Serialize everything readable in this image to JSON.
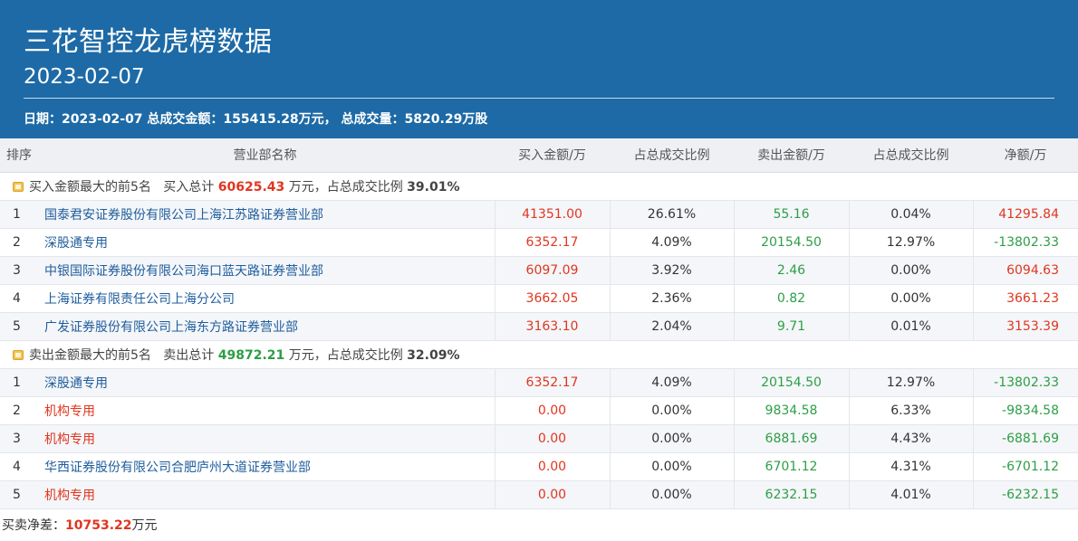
{
  "header": {
    "title": "三花智控龙虎榜数据",
    "date": "2023-02-07",
    "summary": "日期：2023-02-07 总成交金额：155415.28万元， 总成交量：5820.29万股"
  },
  "columns": [
    "排序",
    "营业部名称",
    "买入金额/万",
    "占总成交比例",
    "卖出金额/万",
    "占总成交比例",
    "净额/万"
  ],
  "buy_group": {
    "label": "买入金额最大的前5名",
    "total_label": "买入总计",
    "total_value": "60625.43",
    "unit_text": "万元，占总成交比例",
    "ratio": "39.01%",
    "rows": [
      {
        "rank": "1",
        "name": "国泰君安证券股份有限公司上海江苏路证券营业部",
        "buy": "41351.00",
        "buy_pct": "26.61%",
        "sell": "55.16",
        "sell_pct": "0.04%",
        "net": "41295.84"
      },
      {
        "rank": "2",
        "name": "深股通专用",
        "buy": "6352.17",
        "buy_pct": "4.09%",
        "sell": "20154.50",
        "sell_pct": "12.97%",
        "net": "-13802.33"
      },
      {
        "rank": "3",
        "name": "中银国际证券股份有限公司海口蓝天路证券营业部",
        "buy": "6097.09",
        "buy_pct": "3.92%",
        "sell": "2.46",
        "sell_pct": "0.00%",
        "net": "6094.63"
      },
      {
        "rank": "4",
        "name": "上海证券有限责任公司上海分公司",
        "buy": "3662.05",
        "buy_pct": "2.36%",
        "sell": "0.82",
        "sell_pct": "0.00%",
        "net": "3661.23"
      },
      {
        "rank": "5",
        "name": "广发证券股份有限公司上海东方路证券营业部",
        "buy": "3163.10",
        "buy_pct": "2.04%",
        "sell": "9.71",
        "sell_pct": "0.01%",
        "net": "3153.39"
      }
    ]
  },
  "sell_group": {
    "label": "卖出金额最大的前5名",
    "total_label": "卖出总计",
    "total_value": "49872.21",
    "unit_text": "万元，占总成交比例",
    "ratio": "32.09%",
    "rows": [
      {
        "rank": "1",
        "name": "深股通专用",
        "buy": "6352.17",
        "buy_pct": "4.09%",
        "sell": "20154.50",
        "sell_pct": "12.97%",
        "net": "-13802.33"
      },
      {
        "rank": "2",
        "name": "机构专用",
        "buy": "0.00",
        "buy_pct": "0.00%",
        "sell": "9834.58",
        "sell_pct": "6.33%",
        "net": "-9834.58"
      },
      {
        "rank": "3",
        "name": "机构专用",
        "buy": "0.00",
        "buy_pct": "0.00%",
        "sell": "6881.69",
        "sell_pct": "4.43%",
        "net": "-6881.69"
      },
      {
        "rank": "4",
        "name": "华西证券股份有限公司合肥庐州大道证券营业部",
        "buy": "0.00",
        "buy_pct": "0.00%",
        "sell": "6701.12",
        "sell_pct": "4.31%",
        "net": "-6701.12"
      },
      {
        "rank": "5",
        "name": "机构专用",
        "buy": "0.00",
        "buy_pct": "0.00%",
        "sell": "6232.15",
        "sell_pct": "4.01%",
        "net": "-6232.15"
      }
    ]
  },
  "footer": {
    "label": "买卖净差：",
    "value": "10753.22",
    "unit": "万元"
  },
  "colors": {
    "header_bg": "#1d6aa6",
    "up_red": "#e0361f",
    "down_green": "#2d9e46",
    "link_blue": "#1f5d9c"
  }
}
